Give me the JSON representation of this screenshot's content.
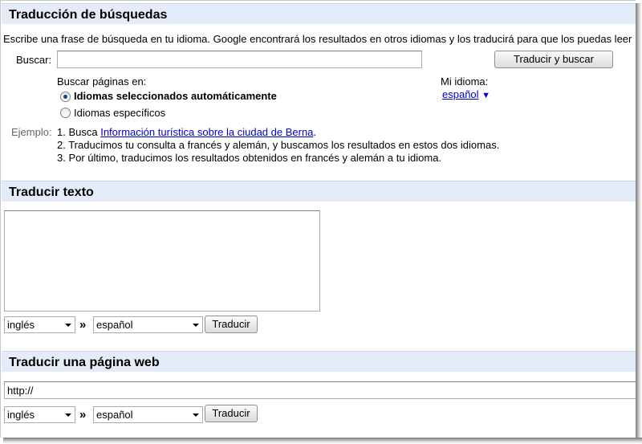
{
  "search_translation": {
    "title": "Traducción de búsquedas",
    "description": "Escribe una frase de búsqueda en tu idioma. Google encontrará los resultados en otros idiomas y los traducirá para que los puedas leer",
    "search_label": "Buscar:",
    "search_value": "",
    "submit_label": "Traducir y buscar",
    "pages_in_label": "Buscar páginas en:",
    "option_auto": "Idiomas seleccionados automáticamente",
    "option_specific": "Idiomas específicos",
    "my_language_label": "Mi idioma:",
    "my_language_value": "español",
    "my_language_caret": "▼",
    "example_label": "Ejemplo:",
    "example_step1_prefix": "1. Busca ",
    "example_step1_link": "Información turística sobre la ciudad de Berna",
    "example_step1_suffix": ".",
    "example_step2": "2. Traducimos tu consulta a francés y alemán, y buscamos los resultados en estos dos idiomas.",
    "example_step3": "3. Por último, traducimos los resultados obtenidos en francés y alemán a tu idioma."
  },
  "text_translation": {
    "title": "Traducir texto",
    "text_value": "",
    "source_language": "inglés",
    "arrow": "»",
    "target_language": "español",
    "submit_label": "Traducir"
  },
  "web_translation": {
    "title": "Traducir una página web",
    "url_value": "http://",
    "source_language": "inglés",
    "arrow": "»",
    "target_language": "español",
    "submit_label": "Traducir"
  }
}
